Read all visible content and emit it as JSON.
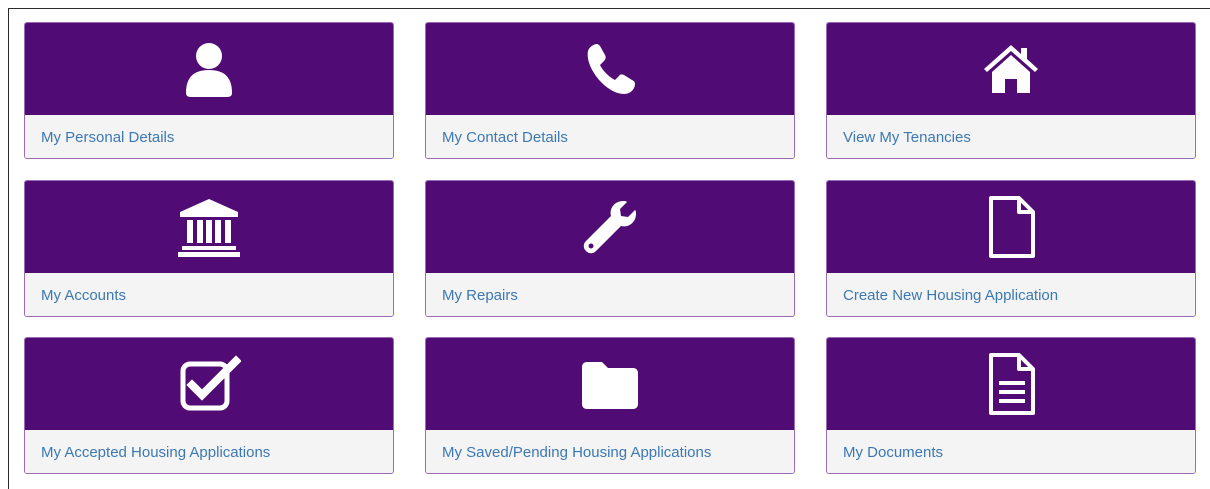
{
  "colors": {
    "tile_header": "#510b74",
    "tile_border": "#9b6bb5",
    "tile_footer": "#f4f4f4",
    "link_text": "#3c78b4",
    "icon": "#ffffff"
  },
  "tiles": [
    {
      "label": "My Personal Details",
      "icon": "person-icon"
    },
    {
      "label": "My Contact Details",
      "icon": "phone-icon"
    },
    {
      "label": "View My Tenancies",
      "icon": "home-icon"
    },
    {
      "label": "My Accounts",
      "icon": "bank-icon"
    },
    {
      "label": "My Repairs",
      "icon": "wrench-icon"
    },
    {
      "label": "Create New Housing Application",
      "icon": "blank-file-icon"
    },
    {
      "label": "My Accepted Housing Applications",
      "icon": "checkbox-icon"
    },
    {
      "label": "My Saved/Pending Housing Applications",
      "icon": "folder-icon"
    },
    {
      "label": "My Documents",
      "icon": "document-icon"
    }
  ]
}
